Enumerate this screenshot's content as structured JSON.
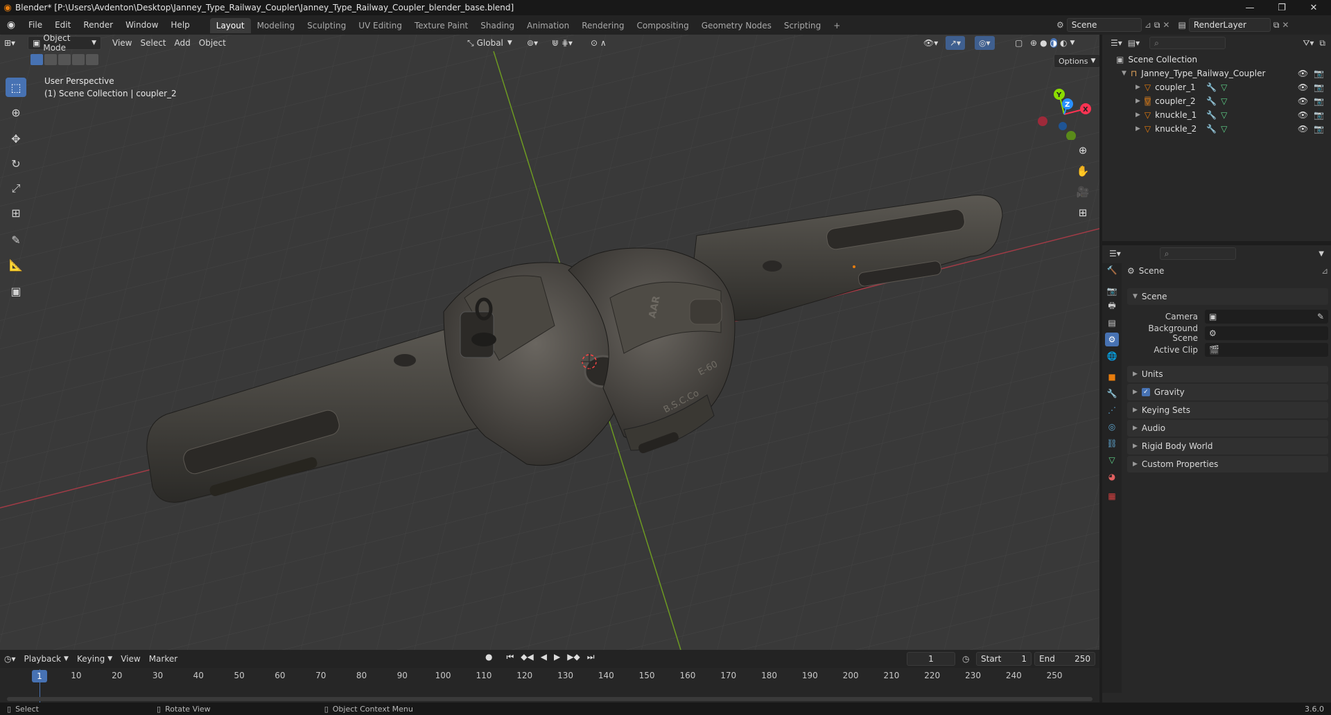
{
  "window": {
    "title": "Blender* [P:\\Users\\Avdenton\\Desktop\\Janney_Type_Railway_Coupler\\Janney_Type_Railway_Coupler_blender_base.blend]",
    "buttons": [
      "—",
      "❐",
      "✕"
    ]
  },
  "menus": [
    "File",
    "Edit",
    "Render",
    "Window",
    "Help"
  ],
  "workspaces": [
    "Layout",
    "Modeling",
    "Sculpting",
    "UV Editing",
    "Texture Paint",
    "Shading",
    "Animation",
    "Rendering",
    "Compositing",
    "Geometry Nodes",
    "Scripting",
    "+"
  ],
  "scene_field": "Scene",
  "renderlayer_field": "RenderLayer",
  "viewport": {
    "mode": "Object Mode",
    "menus": [
      "View",
      "Select",
      "Add",
      "Object"
    ],
    "orientation": "Global",
    "options": "Options",
    "overlay_line1": "User Perspective",
    "overlay_line2": "(1) Scene Collection | coupler_2",
    "gizmo": {
      "x": "X",
      "y": "Y",
      "z": "Z"
    },
    "stamps": [
      "AAR",
      "E-60",
      "B.S.C.Co"
    ]
  },
  "outliner": {
    "root": "Scene Collection",
    "collection": "Janney_Type_Railway_Coupler",
    "items": [
      "coupler_1",
      "coupler_2",
      "knuckle_1",
      "knuckle_2"
    ]
  },
  "properties": {
    "header": "Scene",
    "panel": "Scene",
    "fields": [
      {
        "label": "Camera",
        "value": ""
      },
      {
        "label": "Background Scene",
        "value": ""
      },
      {
        "label": "Active Clip",
        "value": ""
      }
    ],
    "sections": [
      "Units",
      "Gravity",
      "Keying Sets",
      "Audio",
      "Rigid Body World",
      "Custom Properties"
    ],
    "gravity_checked": true
  },
  "timeline": {
    "menus": [
      "Playback",
      "Keying",
      "View",
      "Marker"
    ],
    "current_frame": "1",
    "start_label": "Start",
    "start": "1",
    "end_label": "End",
    "end": "250",
    "ruler": [
      "1",
      "10",
      "20",
      "30",
      "40",
      "50",
      "60",
      "70",
      "80",
      "90",
      "100",
      "110",
      "120",
      "130",
      "140",
      "150",
      "160",
      "170",
      "180",
      "190",
      "200",
      "210",
      "220",
      "230",
      "240",
      "250"
    ]
  },
  "statusbar": {
    "select": "Select",
    "rotate": "Rotate View",
    "context": "Object Context Menu",
    "version": "3.6.0"
  },
  "colors": {
    "accent": "#4772b3",
    "x_axis": "#ff3352",
    "y_axis": "#8bdc00",
    "z_axis": "#2890ff",
    "object": "#e87d0d"
  }
}
